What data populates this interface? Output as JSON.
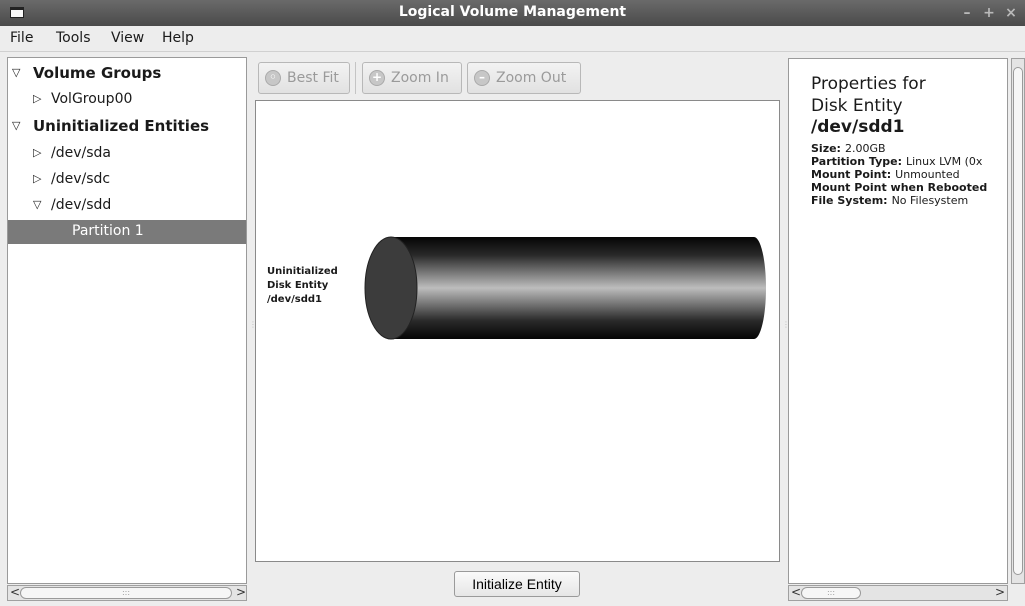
{
  "window": {
    "title": "Logical Volume Management"
  },
  "menu": [
    {
      "label": "File"
    },
    {
      "label": "Tools"
    },
    {
      "label": "View"
    },
    {
      "label": "Help"
    }
  ],
  "tree": {
    "volume_groups": {
      "label": "Volume Groups",
      "children": [
        "VolGroup00"
      ]
    },
    "uninitialized": {
      "label": "Uninitialized Entities",
      "children": [
        "/dev/sda",
        "/dev/sdc",
        "/dev/sdd"
      ]
    },
    "selected_partition": "Partition 1"
  },
  "toolbar": {
    "best_fit": "Best Fit",
    "zoom_in": "Zoom In",
    "zoom_out": "Zoom Out"
  },
  "canvas": {
    "label_line1": "Uninitialized",
    "label_line2": "Disk Entity",
    "label_line3": "/dev/sdd1"
  },
  "initialize_button": "Initialize Entity",
  "properties": {
    "title_line1": "Properties for",
    "title_line2": "Disk Entity",
    "device": "/dev/sdd1",
    "rows": [
      {
        "key": "Size:",
        "value": "2.00GB"
      },
      {
        "key": "Partition Type:",
        "value": "Linux LVM (0x"
      },
      {
        "key": "Mount Point:",
        "value": "Unmounted"
      },
      {
        "key": "Mount Point when Rebooted",
        "value": ""
      },
      {
        "key": "File System:",
        "value": "No Filesystem"
      }
    ]
  }
}
